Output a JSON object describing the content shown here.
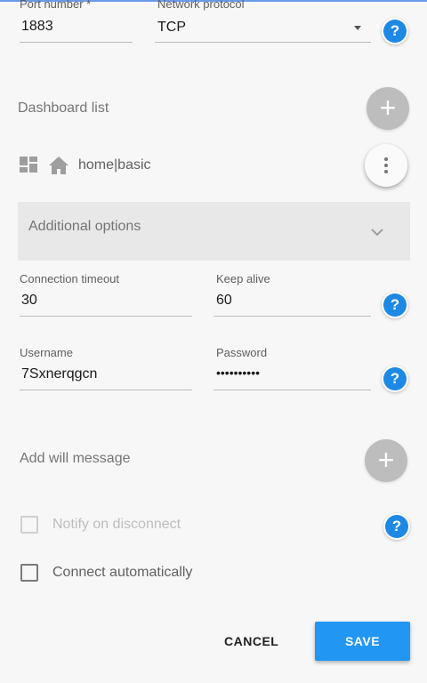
{
  "connection": {
    "port": {
      "label": "Port number *",
      "value": "1883"
    },
    "protocol": {
      "label": "Network protocol",
      "value": "TCP"
    }
  },
  "dashboards": {
    "title": "Dashboard list",
    "add_icon": "plus-icon",
    "item": {
      "name": "home|basic",
      "grid_icon": "dashboard-icon",
      "home_icon": "home-icon",
      "menu_icon": "more-vert-icon"
    }
  },
  "additional": {
    "title": "Additional options",
    "icon": "chevron-down-icon"
  },
  "timeout": {
    "label": "Connection timeout",
    "value": "30"
  },
  "keepalive": {
    "label": "Keep alive",
    "value": "60"
  },
  "username": {
    "label": "Username",
    "value": "7Sxnerqgcn"
  },
  "password": {
    "label": "Password",
    "value": "••••••••••"
  },
  "will": {
    "title": "Add will message"
  },
  "notify": {
    "label": "Notify on disconnect",
    "checked": false,
    "disabled": true
  },
  "auto_connect": {
    "label": "Connect automatically",
    "checked": false
  },
  "actions": {
    "cancel": "CANCEL",
    "save": "SAVE"
  },
  "help_glyph": "?",
  "colors": {
    "accent": "#2196f3",
    "help": "#1e88e5",
    "fab": "#bdbdbd",
    "panel": "#e8e8e8"
  }
}
